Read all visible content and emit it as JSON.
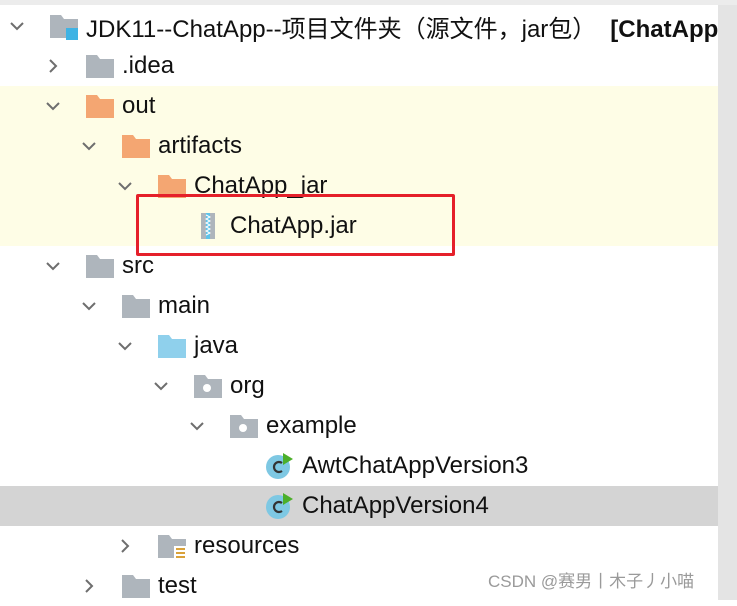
{
  "tree": [
    {
      "depth": 0,
      "label": "JDK11--ChatApp--项目文件夹（源文件，jar包）",
      "suffix": "[ChatApp]",
      "icon": "module-folder-icon",
      "chevron": "down"
    },
    {
      "depth": 1,
      "label": ".idea",
      "icon": "folder-gray-icon",
      "chevron": "right"
    },
    {
      "depth": 1,
      "label": "out",
      "icon": "folder-orange-icon",
      "chevron": "down"
    },
    {
      "depth": 2,
      "label": "artifacts",
      "icon": "folder-orange-icon",
      "chevron": "down"
    },
    {
      "depth": 3,
      "label": "ChatApp_jar",
      "icon": "folder-orange-icon",
      "chevron": "down"
    },
    {
      "depth": 4,
      "label": "ChatApp.jar",
      "icon": "jar-archive-icon",
      "chevron": "none"
    },
    {
      "depth": 1,
      "label": "src",
      "icon": "folder-gray-icon",
      "chevron": "down"
    },
    {
      "depth": 2,
      "label": "main",
      "icon": "folder-gray-icon",
      "chevron": "down"
    },
    {
      "depth": 3,
      "label": "java",
      "icon": "source-folder-icon",
      "chevron": "down"
    },
    {
      "depth": 4,
      "label": "org",
      "icon": "package-icon",
      "chevron": "down"
    },
    {
      "depth": 5,
      "label": "example",
      "icon": "package-icon",
      "chevron": "down"
    },
    {
      "depth": 6,
      "label": "AwtChatAppVersion3",
      "icon": "java-class-runnable-icon",
      "chevron": "none"
    },
    {
      "depth": 6,
      "label": "ChatAppVersion4",
      "icon": "java-class-runnable-icon",
      "chevron": "none",
      "selected": true
    },
    {
      "depth": 3,
      "label": "resources",
      "icon": "resources-folder-icon",
      "chevron": "right"
    },
    {
      "depth": 2,
      "label": "test",
      "icon": "folder-gray-icon",
      "chevron": "right"
    }
  ],
  "colors": {
    "highlight_band": "#fefde6",
    "selection": "#d4d4d4",
    "red_box": "#e5202a",
    "folder_gray": "#aeb5bc",
    "folder_orange": "#f4a672",
    "folder_blue": "#8fd0ec"
  },
  "watermark": "CSDN @赛男丨木子丿小喵"
}
